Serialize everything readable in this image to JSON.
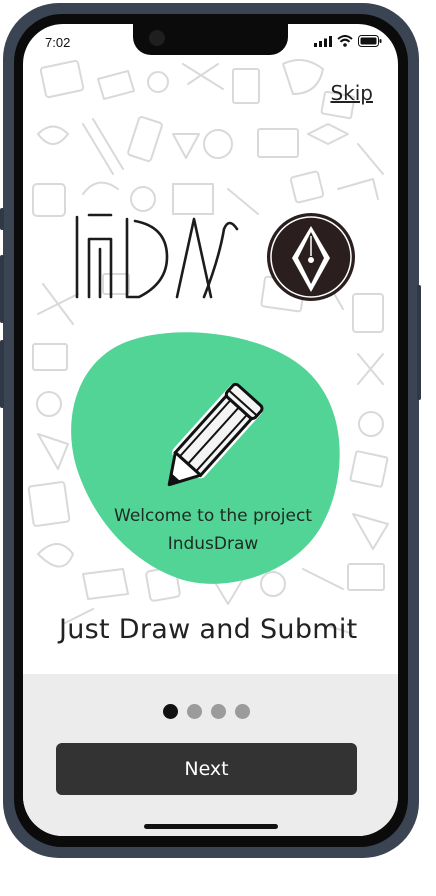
{
  "status_bar": {
    "time": "7:02"
  },
  "header": {
    "skip_label": "Skip"
  },
  "hero": {
    "welcome_line1": "Welcome to the project",
    "welcome_line2": "IndusDraw",
    "headline": "Just Draw and Submit"
  },
  "pagination": {
    "total": 4,
    "active": 0
  },
  "footer": {
    "next_label": "Next"
  },
  "colors": {
    "accent_green": "#52d496",
    "button_dark": "#333333",
    "bottom_panel": "#ececec",
    "frame": "#3a4452"
  },
  "icons": [
    "signal-icon",
    "wifi-icon",
    "battery-icon",
    "pencil-icon",
    "pen-nib-icon",
    "indusdraw-wordmark"
  ]
}
